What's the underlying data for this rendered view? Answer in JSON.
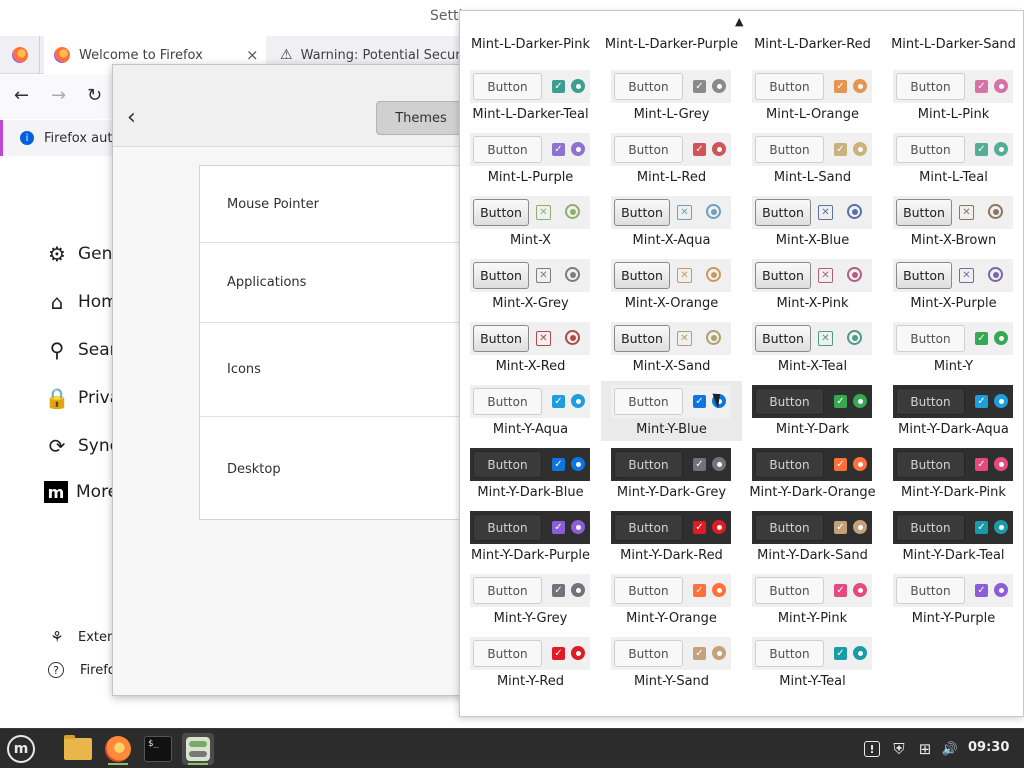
{
  "firefox": {
    "window_title_fragment": "Setti",
    "tabs": [
      {
        "label": ""
      },
      {
        "label": "Welcome to Firefox",
        "close": "×"
      },
      {
        "label": "Warning: Potential Securit"
      }
    ],
    "notification": "Firefox auto",
    "nav": {
      "back": "←",
      "forward": "→",
      "reload": "↻"
    },
    "sidebar": [
      {
        "label": "Gene",
        "icon": "⚙"
      },
      {
        "label": "Hom",
        "icon": "⌂"
      },
      {
        "label": "Sear",
        "icon": "⚲"
      },
      {
        "label": "Priva",
        "icon": "🔒"
      },
      {
        "label": "Sync",
        "icon": "⟳"
      },
      {
        "label": "More",
        "icon": "m"
      }
    ],
    "sidebar_bottom": [
      {
        "label": "Exten",
        "icon": "⚘"
      },
      {
        "label": "Firefo",
        "icon": "?"
      }
    ]
  },
  "settings": {
    "back": "‹",
    "tab_themes": "Themes",
    "rows": [
      "Mouse Pointer",
      "Applications",
      "Icons",
      "Desktop"
    ]
  },
  "popup": {
    "scroll_up": "▲",
    "button_label": "Button",
    "check_glyph": "✓",
    "x_check_glyph": "✕",
    "themes": [
      {
        "name": "Mint-L-Darker-Pink",
        "style": "l",
        "accent": "#d76a8e"
      },
      {
        "name": "Mint-L-Darker-Purple",
        "style": "l",
        "accent": "#8b6fc9"
      },
      {
        "name": "Mint-L-Darker-Red",
        "style": "l",
        "accent": "#c6494f"
      },
      {
        "name": "Mint-L-Darker-Sand",
        "style": "l",
        "accent": "#b39b73"
      },
      {
        "name": "Mint-L-Darker-Teal",
        "style": "l",
        "accent": "#3c9e8f"
      },
      {
        "name": "Mint-L-Grey",
        "style": "l",
        "accent": "#8a8a8a"
      },
      {
        "name": "Mint-L-Orange",
        "style": "l",
        "accent": "#e5954f"
      },
      {
        "name": "Mint-L-Pink",
        "style": "l",
        "accent": "#d772a6"
      },
      {
        "name": "Mint-L-Purple",
        "style": "l",
        "accent": "#8e72d0"
      },
      {
        "name": "Mint-L-Red",
        "style": "l",
        "accent": "#d05358"
      },
      {
        "name": "Mint-L-Sand",
        "style": "l",
        "accent": "#c9b27d"
      },
      {
        "name": "Mint-L-Teal",
        "style": "l",
        "accent": "#54ad94"
      },
      {
        "name": "Mint-X",
        "style": "x",
        "accent": "#8fae6e"
      },
      {
        "name": "Mint-X-Aqua",
        "style": "x",
        "accent": "#6ea0c0"
      },
      {
        "name": "Mint-X-Blue",
        "style": "x",
        "accent": "#5c6fa8"
      },
      {
        "name": "Mint-X-Brown",
        "style": "x",
        "accent": "#8c7560"
      },
      {
        "name": "Mint-X-Grey",
        "style": "x",
        "accent": "#7d7d7d"
      },
      {
        "name": "Mint-X-Orange",
        "style": "x",
        "accent": "#c89b5d"
      },
      {
        "name": "Mint-X-Pink",
        "style": "x",
        "accent": "#b05f82"
      },
      {
        "name": "Mint-X-Purple",
        "style": "x",
        "accent": "#7a66a8"
      },
      {
        "name": "Mint-X-Red",
        "style": "x",
        "accent": "#b04a4a"
      },
      {
        "name": "Mint-X-Sand",
        "style": "x",
        "accent": "#b0a06a"
      },
      {
        "name": "Mint-X-Teal",
        "style": "x",
        "accent": "#4f9a88"
      },
      {
        "name": "Mint-Y",
        "style": "y",
        "accent": "#35a854"
      },
      {
        "name": "Mint-Y-Aqua",
        "style": "y",
        "accent": "#1f9ede"
      },
      {
        "name": "Mint-Y-Blue",
        "style": "y",
        "accent": "#0c75de"
      },
      {
        "name": "Mint-Y-Dark",
        "style": "d",
        "accent": "#35a854"
      },
      {
        "name": "Mint-Y-Dark-Aqua",
        "style": "d",
        "accent": "#1f9ede"
      },
      {
        "name": "Mint-Y-Dark-Blue",
        "style": "d",
        "accent": "#0c75de"
      },
      {
        "name": "Mint-Y-Dark-Grey",
        "style": "d",
        "accent": "#70737a"
      },
      {
        "name": "Mint-Y-Dark-Orange",
        "style": "d",
        "accent": "#ff7139"
      },
      {
        "name": "Mint-Y-Dark-Pink",
        "style": "d",
        "accent": "#e54980"
      },
      {
        "name": "Mint-Y-Dark-Purple",
        "style": "d",
        "accent": "#8c5dd9"
      },
      {
        "name": "Mint-Y-Dark-Red",
        "style": "d",
        "accent": "#e01b24"
      },
      {
        "name": "Mint-Y-Dark-Sand",
        "style": "d",
        "accent": "#c5a07c"
      },
      {
        "name": "Mint-Y-Dark-Teal",
        "style": "d",
        "accent": "#199ca8"
      },
      {
        "name": "Mint-Y-Grey",
        "style": "y",
        "accent": "#70737a"
      },
      {
        "name": "Mint-Y-Orange",
        "style": "y",
        "accent": "#ff7139"
      },
      {
        "name": "Mint-Y-Pink",
        "style": "y",
        "accent": "#e54980"
      },
      {
        "name": "Mint-Y-Purple",
        "style": "y",
        "accent": "#8c5dd9"
      },
      {
        "name": "Mint-Y-Red",
        "style": "y",
        "accent": "#e01b24"
      },
      {
        "name": "Mint-Y-Sand",
        "style": "y",
        "accent": "#c5a07c"
      },
      {
        "name": "Mint-Y-Teal",
        "style": "y",
        "accent": "#199ca8"
      }
    ],
    "hovered": "Mint-Y-Blue"
  },
  "taskbar": {
    "apps": [
      {
        "name": "menu-icon"
      },
      {
        "name": "files-icon"
      },
      {
        "name": "firefox-icon"
      },
      {
        "name": "terminal-icon",
        "text": "$_"
      },
      {
        "name": "themes-app-icon"
      }
    ],
    "tray": [
      {
        "name": "notification-icon",
        "glyph": "!"
      },
      {
        "name": "shield-icon",
        "glyph": "⛨"
      },
      {
        "name": "network-icon",
        "glyph": "⊞"
      },
      {
        "name": "volume-icon",
        "glyph": "🔊"
      }
    ],
    "clock": "09:30"
  }
}
